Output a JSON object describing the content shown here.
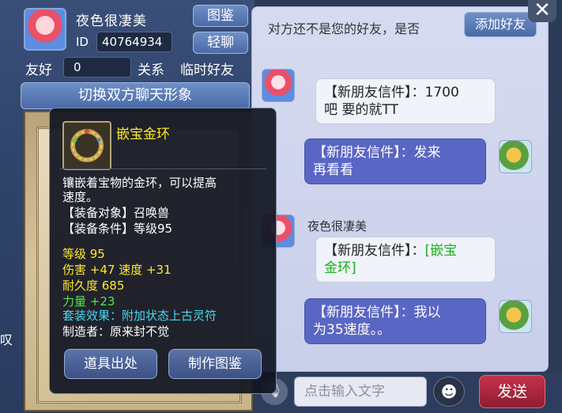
{
  "profile": {
    "name": "夜色很凄美",
    "id_label": "ID",
    "id_value": "40764934",
    "friendliness_label": "友好",
    "friendliness_value": "0",
    "relation_label": "关系",
    "relation_value": "临时好友",
    "avatar_icon": "girl-avatar"
  },
  "buttons": {
    "tujian": "图鉴",
    "qingliao": "轻聊",
    "switch_image": "切换双方聊天形象",
    "add_friend": "添加好友",
    "close": "✕",
    "send": "发送"
  },
  "chat": {
    "notice": "对方还不是您的好友，是否",
    "messages": [
      {
        "side": "left",
        "sender": "",
        "avatar": "girl-avatar",
        "lines": [
          "【新朋友信件】：1700",
          "吧 要的就TT"
        ]
      },
      {
        "side": "right",
        "sender": "",
        "avatar": "bird-avatar",
        "lines": [
          "【新朋友信件】：发来",
          "再看看"
        ]
      },
      {
        "side": "left",
        "sender": "夜色很凄美",
        "avatar": "girl-avatar",
        "prefix": "【新朋友信件】：",
        "link_part1": "[嵌宝",
        "link_part2": "金环]"
      },
      {
        "side": "right",
        "sender": "",
        "avatar": "bird-avatar",
        "lines": [
          "【新朋友信件】：我以",
          "为35速度。。"
        ]
      }
    ]
  },
  "input": {
    "placeholder": "点击输入文字",
    "mic_icon": "microphone-icon",
    "emoji_icon": "emoji-icon"
  },
  "tooltip": {
    "item_name": "嵌宝金环",
    "item_icon": "gold-ring-icon",
    "description_line1": "镶嵌着宝物的金环，可以提高",
    "description_line2": "速度。",
    "equip_target": "【装备对象】召唤兽",
    "equip_condition": "【装备条件】等级95",
    "level": "等级 95",
    "damage_speed": "伤害 +47 速度 +31",
    "durability": "耐久度 685",
    "strength": "力量 +23",
    "set_effect": "套装效果：附加状态上古灵符",
    "maker": "制造者：原来封不觉",
    "btn_source": "道具出处",
    "btn_craft": "制作图鉴"
  },
  "misc": {
    "edge_char": "叹"
  }
}
